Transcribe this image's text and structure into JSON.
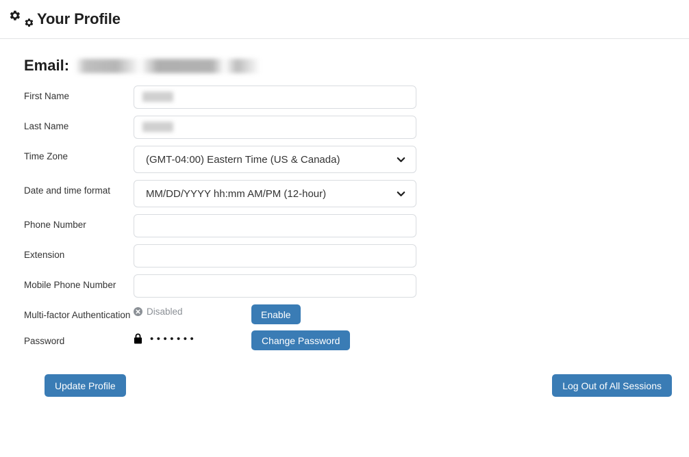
{
  "header": {
    "icon": "cogs-icon",
    "title": "Your Profile"
  },
  "profile": {
    "email_label": "Email:",
    "email_value": "",
    "email_redacted": true,
    "fields": [
      {
        "id": "first-name",
        "label": "First Name",
        "type": "text",
        "value": "",
        "placeholder": "",
        "redacted": true
      },
      {
        "id": "last-name",
        "label": "Last Name",
        "type": "text",
        "value": "",
        "placeholder": "",
        "redacted": true
      },
      {
        "id": "time-zone",
        "label": "Time Zone",
        "type": "select",
        "value": "(GMT-04:00) Eastern Time (US & Canada)",
        "redacted": false
      },
      {
        "id": "date-time-format",
        "label": "Date and time format",
        "type": "select",
        "value": "MM/DD/YYYY hh:mm AM/PM (12-hour)",
        "redacted": false
      },
      {
        "id": "phone-number",
        "label": "Phone Number",
        "type": "text",
        "value": "",
        "placeholder": "",
        "redacted": false
      },
      {
        "id": "extension",
        "label": "Extension",
        "type": "text",
        "value": "",
        "placeholder": "",
        "redacted": false
      },
      {
        "id": "mobile-phone-number",
        "label": "Mobile Phone Number",
        "type": "text",
        "value": "",
        "placeholder": "",
        "redacted": false
      }
    ],
    "mfa": {
      "label": "Multi-factor Authentication",
      "status_icon": "x-circle-icon",
      "status_text": "Disabled",
      "button_label": "Enable"
    },
    "password": {
      "label": "Password",
      "status_icon": "lock-icon",
      "masked_value": "•••••••",
      "button_label": "Change Password"
    }
  },
  "footer": {
    "update_label": "Update Profile",
    "logout_label": "Log Out of All Sessions"
  },
  "colors": {
    "button_blue": "#3a7cb5",
    "label_text": "#333333",
    "muted_text": "#8b9096",
    "border": "#d9dce0",
    "header_rule": "#e2e3e5"
  }
}
